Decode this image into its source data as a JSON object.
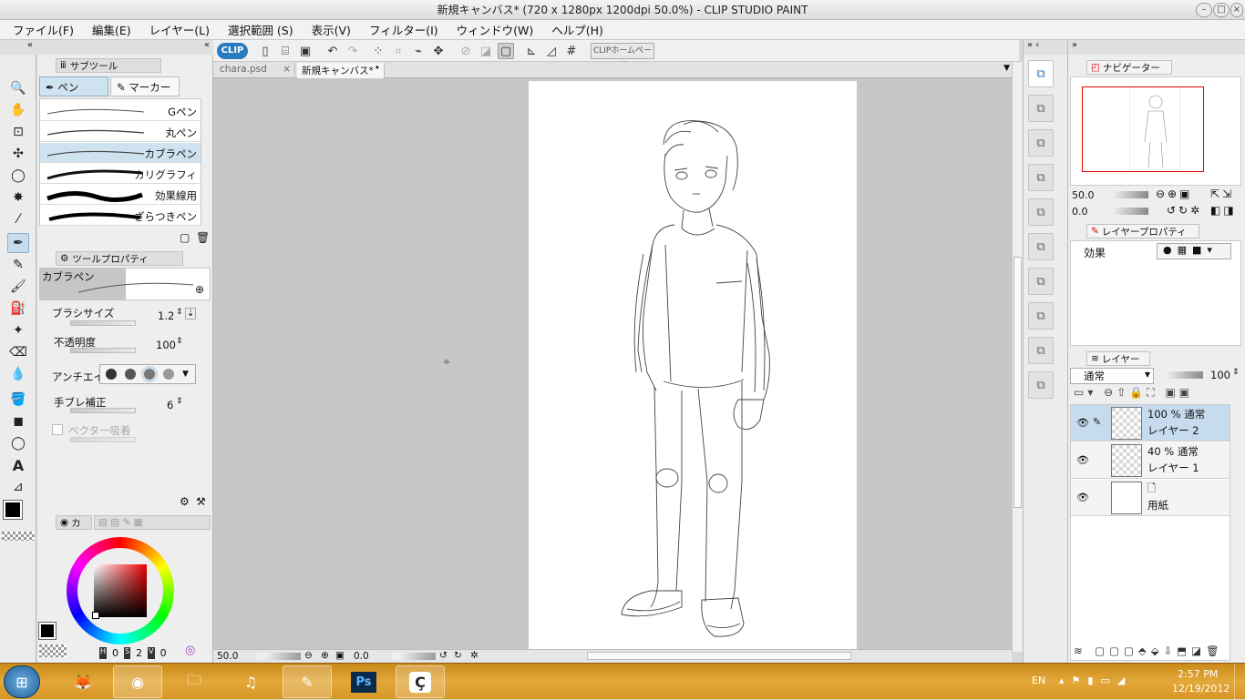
{
  "window": {
    "title": "新規キャンバス* (720 x 1280px 1200dpi 50.0%) - CLIP STUDIO PAINT"
  },
  "menu": [
    "ファイル(F)",
    "編集(E)",
    "レイヤー(L)",
    "選択範囲 (S)",
    "表示(V)",
    "フィルター(I)",
    "ウィンドウ(W)",
    "ヘルプ(H)"
  ],
  "command_bar": {
    "clip_label": "CLIP",
    "homepage_label": "CLIPホームページ"
  },
  "subtool": {
    "tab_label": "サブツール",
    "groups": [
      "ペン",
      "マーカー"
    ],
    "brushes": [
      "Gペン",
      "丸ペン",
      "カブラペン",
      "カリグラフィ",
      "効果線用",
      "ざらつきペン"
    ]
  },
  "tool_property": {
    "tab_label": "ツールプロパティ",
    "brush_name": "カブラペン",
    "brush_size_label": "ブラシサイズ",
    "brush_size_value": "1.2",
    "opacity_label": "不透明度",
    "opacity_value": "100",
    "antialias_label": "アンチエイ",
    "stabilization_label": "手ブレ補正",
    "stabilization_value": "6",
    "vector_snap_label": "ベクター吸着"
  },
  "color_panel": {
    "tab_label": "カ",
    "main_color": "#000000",
    "sub_color": "#d4c4b4",
    "h_value": "0",
    "s_value": "2",
    "v_value": "0",
    "h_label": "H",
    "s_label": "S",
    "v_label": "V"
  },
  "document_tabs": [
    {
      "label": "chara.psd"
    },
    {
      "label": "新規キャンバス*"
    }
  ],
  "status": {
    "zoom": "50.0",
    "rotation": "0.0"
  },
  "navigator": {
    "tab_label": "ナビゲーター",
    "zoom": "50.0",
    "rotation": "0.0"
  },
  "layer_property": {
    "tab_label": "レイヤープロパティ",
    "effect_label": "効果"
  },
  "layer_panel": {
    "tab_label": "レイヤー",
    "blend_mode": "通常",
    "opacity": "100",
    "layers": [
      {
        "opacity_mode": "100 %  通常",
        "name": "レイヤー 2"
      },
      {
        "opacity_mode": "40 %  通常",
        "name": "レイヤー 1"
      },
      {
        "opacity_mode": "",
        "name": "用紙"
      }
    ]
  },
  "taskbar": {
    "apps": [
      "firefox-icon",
      "chrome-icon",
      "explorer-icon",
      "itunes-icon",
      "sai-icon",
      "photoshop-icon",
      "clip-studio-icon"
    ],
    "photoshop_label": "Ps",
    "lang": "EN",
    "time": "2:57 PM",
    "date": "12/19/2012"
  }
}
